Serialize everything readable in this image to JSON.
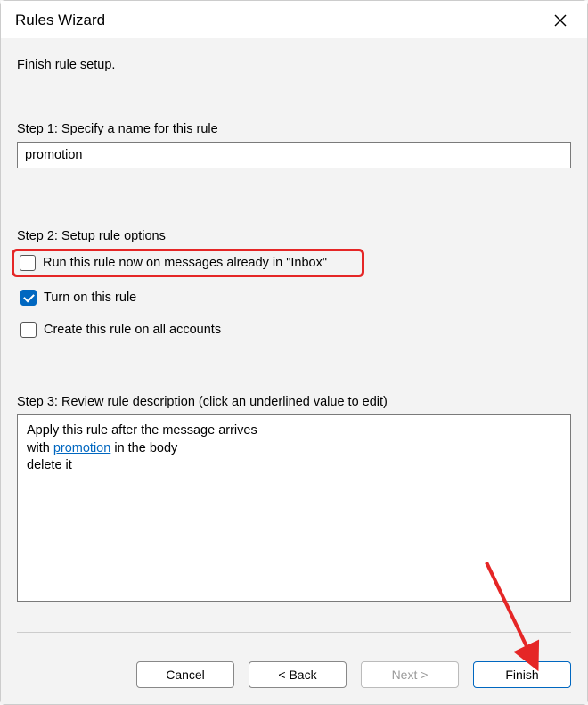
{
  "titlebar": {
    "title": "Rules Wizard"
  },
  "instruction": "Finish rule setup.",
  "step1": {
    "label": "Step 1: Specify a name for this rule",
    "value": "promotion"
  },
  "step2": {
    "label": "Step 2: Setup rule options",
    "opt_run_now": "Run this rule now on messages already in \"Inbox\"",
    "opt_turn_on": "Turn on this rule",
    "opt_all_accounts": "Create this rule on all accounts"
  },
  "step3": {
    "label": "Step 3: Review rule description (click an underlined value to edit)",
    "line1": "Apply this rule after the message arrives",
    "line2_prefix": "with ",
    "line2_link": "promotion",
    "line2_suffix": " in the body",
    "line3": "delete it"
  },
  "buttons": {
    "cancel": "Cancel",
    "back": "< Back",
    "next": "Next >",
    "finish": "Finish"
  }
}
